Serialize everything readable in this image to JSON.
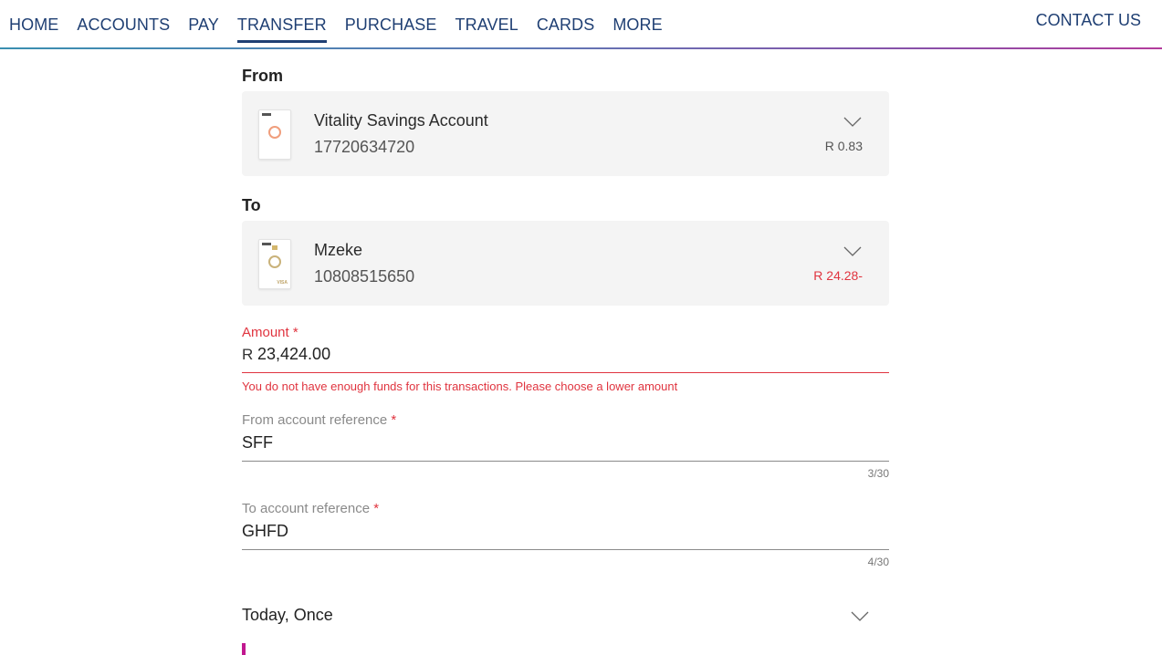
{
  "nav": {
    "items": [
      {
        "label": "HOME"
      },
      {
        "label": "ACCOUNTS"
      },
      {
        "label": "PAY"
      },
      {
        "label": "TRANSFER",
        "active": true
      },
      {
        "label": "PURCHASE"
      },
      {
        "label": "TRAVEL"
      },
      {
        "label": "CARDS"
      },
      {
        "label": "MORE"
      }
    ],
    "contact": "CONTACT US",
    "accent_gradient": [
      "#3a8fb0",
      "#5e79b5",
      "#8a4fa8",
      "#b33c9c"
    ]
  },
  "from": {
    "label": "From",
    "account_name": "Vitality Savings Account",
    "account_number": "17720634720",
    "balance": "R 0.83",
    "card_icon": "savings-card-icon"
  },
  "to": {
    "label": "To",
    "account_name": "Mzeke",
    "account_number": "10808515650",
    "balance": "R 24.28-",
    "card_icon": "visa-card-icon"
  },
  "amount": {
    "label": "Amount",
    "required_mark": "*",
    "currency": "R",
    "value": "23,424.00",
    "error": "You do not have enough funds for this transactions. Please choose a lower amount"
  },
  "from_reference": {
    "label": "From account reference",
    "required_mark": "*",
    "value": "SFF",
    "counter": "3/30"
  },
  "to_reference": {
    "label": "To account reference",
    "required_mark": "*",
    "value": "GHFD",
    "counter": "4/30"
  },
  "schedule": {
    "value": "Today, Once"
  },
  "colors": {
    "brand": "#1f3f73",
    "error": "#e0343f",
    "card_bg": "#f4f4f4",
    "accent": "#c1188f"
  }
}
